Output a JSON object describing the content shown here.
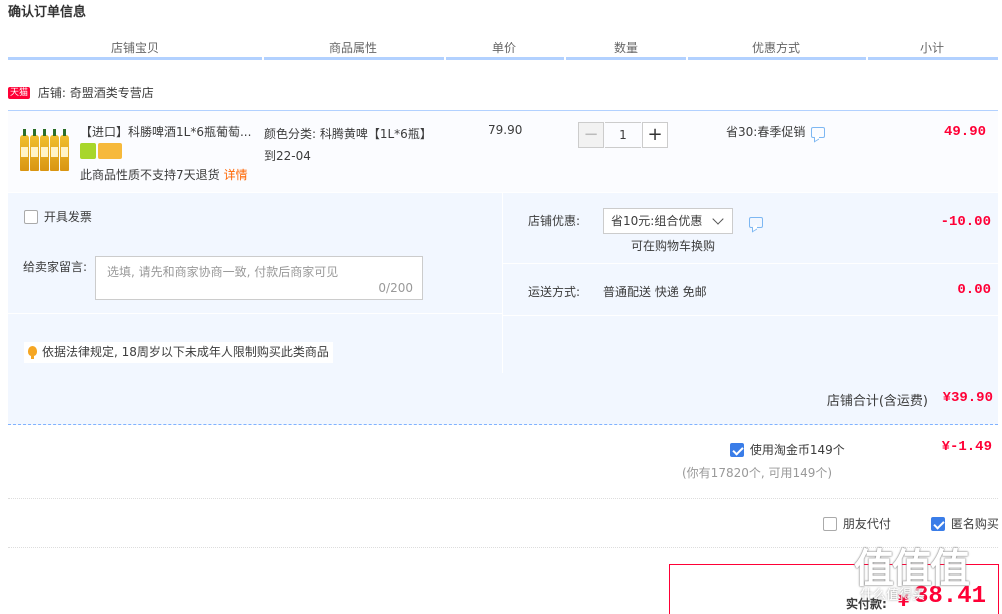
{
  "page": {
    "title": "确认订单信息"
  },
  "table_header": [
    "店铺宝贝",
    "商品属性",
    "单价",
    "数量",
    "优惠方式",
    "小计"
  ],
  "shop": {
    "tag": "天猫",
    "label": "店铺: 奇盟酒类专营店"
  },
  "item": {
    "name": "【进口】科勝啤酒1L*6瓶葡萄...",
    "attr_line1": "颜色分类: 科腾黄啤【1L*6瓶】",
    "attr_line2": "到22-04",
    "price": "79.90",
    "quantity": "1",
    "minus": "−",
    "plus": "+",
    "promo": "省30:春季促销",
    "subtotal": "49.90",
    "notice": "此商品性质不支持7天退货",
    "notice_link": "详情"
  },
  "options": {
    "invoice_label": "开具发票",
    "message_label": "给卖家留言:",
    "message_placeholder": "选填, 请先和商家协商一致, 付款后商家可见",
    "message_count": "0/200",
    "legal_tip": "依据法律规定, 18周岁以下未成年人限制购买此类商品",
    "shop_discount_label": "店铺优惠:",
    "shop_discount_value": "省10元:组合优惠",
    "shop_discount_hint": "可在购物车换购",
    "shop_discount_amount": "-10.00",
    "shipping_label": "运送方式:",
    "shipping_value": "普通配送 快递 免邮",
    "shipping_amount": "0.00"
  },
  "totals": {
    "shop_total_label": "店铺合计(含运费)",
    "shop_total_value": "¥39.90",
    "coin_label": "使用淘金币149个",
    "coin_value": "¥-1.49",
    "coin_hint": "(你有17820个, 可用149个)",
    "friend_pay_label": "朋友代付",
    "anonymous_label": "匿名购买",
    "final_label": "实付款:",
    "final_currency": "¥",
    "final_value": "38.41"
  },
  "watermark": {
    "text": "值值值",
    "sub": "什么值得买"
  },
  "colors": {
    "accent": "#ff0036",
    "header_border": "#b2d1ff",
    "panel_bg": "#f2f7ff",
    "check_blue": "#3a7de8"
  }
}
